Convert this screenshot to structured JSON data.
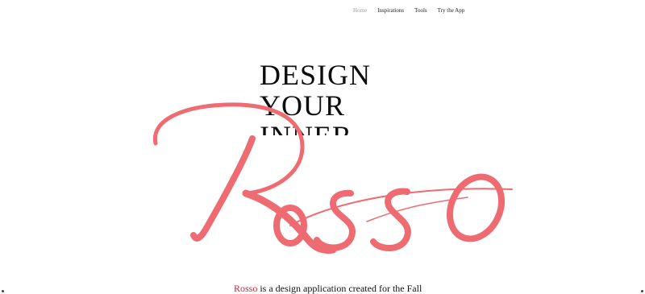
{
  "nav": {
    "items": [
      {
        "label": "Home",
        "active": true
      },
      {
        "label": "Inspirations",
        "active": false
      },
      {
        "label": "Tools",
        "active": false
      },
      {
        "label": "Try the App",
        "active": false
      }
    ]
  },
  "hero": {
    "line1": "DESIGN",
    "line2": "YOUR",
    "line3": "INNER",
    "brand_script": "Rosso",
    "brand_color": "#ee6b72"
  },
  "tagline": {
    "brand_word": "Rosso",
    "rest": " is a design application created for the Fall"
  }
}
